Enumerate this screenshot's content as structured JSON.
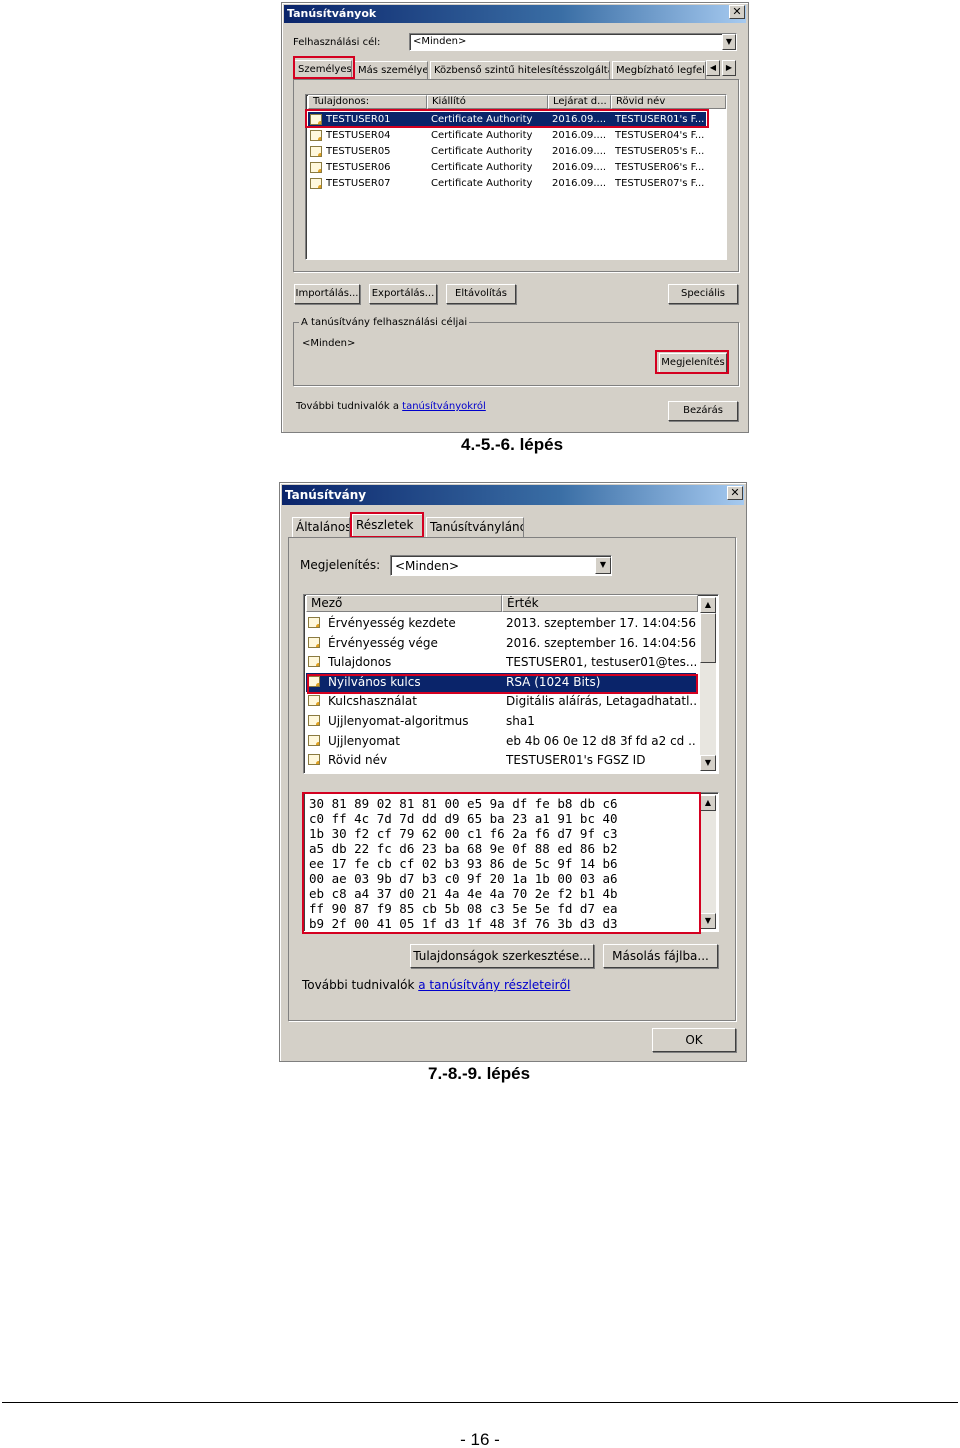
{
  "dialog1": {
    "title": "Tanúsítványok",
    "purpose_label": "Felhasználási cél:",
    "purpose_value": "<Minden>",
    "tabs": [
      "Személyes",
      "Más személyek",
      "Közbenső szintű hitelesítésszolgáltatók",
      "Megbízható legfelső"
    ],
    "columns": [
      "Tulajdonos:",
      "Kiállító",
      "Lejárat d...",
      "Rövid név"
    ],
    "rows": [
      [
        "TESTUSER01",
        "Certificate Authority",
        "2016.09....",
        "TESTUSER01's F..."
      ],
      [
        "TESTUSER04",
        "Certificate Authority",
        "2016.09....",
        "TESTUSER04's F..."
      ],
      [
        "TESTUSER05",
        "Certificate Authority",
        "2016.09....",
        "TESTUSER05's F..."
      ],
      [
        "TESTUSER06",
        "Certificate Authority",
        "2016.09....",
        "TESTUSER06's F..."
      ],
      [
        "TESTUSER07",
        "Certificate Authority",
        "2016.09....",
        "TESTUSER07's F..."
      ]
    ],
    "buttons": {
      "import": "Importálás...",
      "export": "Exportálás...",
      "remove": "Eltávolítás",
      "advanced": "Speciális",
      "view": "Megjelenítés",
      "close": "Bezárás"
    },
    "group_title": "A tanúsítvány felhasználási céljai",
    "group_value": "<Minden>",
    "info_prefix": "További tudnivalók a ",
    "info_link": "tanúsítványokról"
  },
  "caption1": "4.-5.-6. lépés",
  "dialog2": {
    "title": "Tanúsítvány",
    "tabs": [
      "Általános",
      "Részletek",
      "Tanúsítványlánc"
    ],
    "show_label": "Megjelenítés:",
    "show_value": "<Minden>",
    "columns": [
      "Mező",
      "Érték"
    ],
    "rows": [
      [
        "Érvényesség kezdete",
        "2013. szeptember 17. 14:04:56"
      ],
      [
        "Érvényesség vége",
        "2016. szeptember 16. 14:04:56"
      ],
      [
        "Tulajdonos",
        "TESTUSER01, testuser01@tes..."
      ],
      [
        "Nyilvános kulcs",
        "RSA (1024 Bits)"
      ],
      [
        "Kulcshasználat",
        "Digitális aláírás, Letagadhatatl..."
      ],
      [
        "Ujjlenyomat-algoritmus",
        "sha1"
      ],
      [
        "Ujjlenyomat",
        "eb 4b 06 0e 12 d8 3f fd a2 cd ..."
      ],
      [
        "Rövid név",
        "TESTUSER01's FGSZ ID"
      ]
    ],
    "hex_lines": [
      "30 81 89 02 81 81 00 e5 9a df fe b8 db c6",
      "c0 ff 4c 7d 7d dd d9 65 ba 23 a1 91 bc 40",
      "1b 30 f2 cf 79 62 00 c1 f6 2a f6 d7 9f c3",
      "a5 db 22 fc d6 23 ba 68 9e 0f 88 ed 86 b2",
      "ee 17 fe cb cf 02 b3 93 86 de 5c 9f 14 b6",
      "00 ae 03 9b d7 b3 c0 9f 20 1a 1b 00 03 a6",
      "eb c8 a4 37 d0 21 4a 4e 4a 70 2e f2 b1 4b",
      "ff 90 87 f9 85 cb 5b 08 c3 5e 5e fd d7 ea",
      "b9 2f 00 41 05 1f d3 1f 48 3f 76 3b d3 d3"
    ],
    "buttons": {
      "edit_props": "Tulajdonságok szerkesztése...",
      "copy_file": "Másolás fájlba...",
      "ok": "OK"
    },
    "info_prefix": "További tudnivalók ",
    "info_link": "a tanúsítvány részleteiről"
  },
  "caption2": "7.-8.-9. lépés",
  "page_number": "- 16 -"
}
